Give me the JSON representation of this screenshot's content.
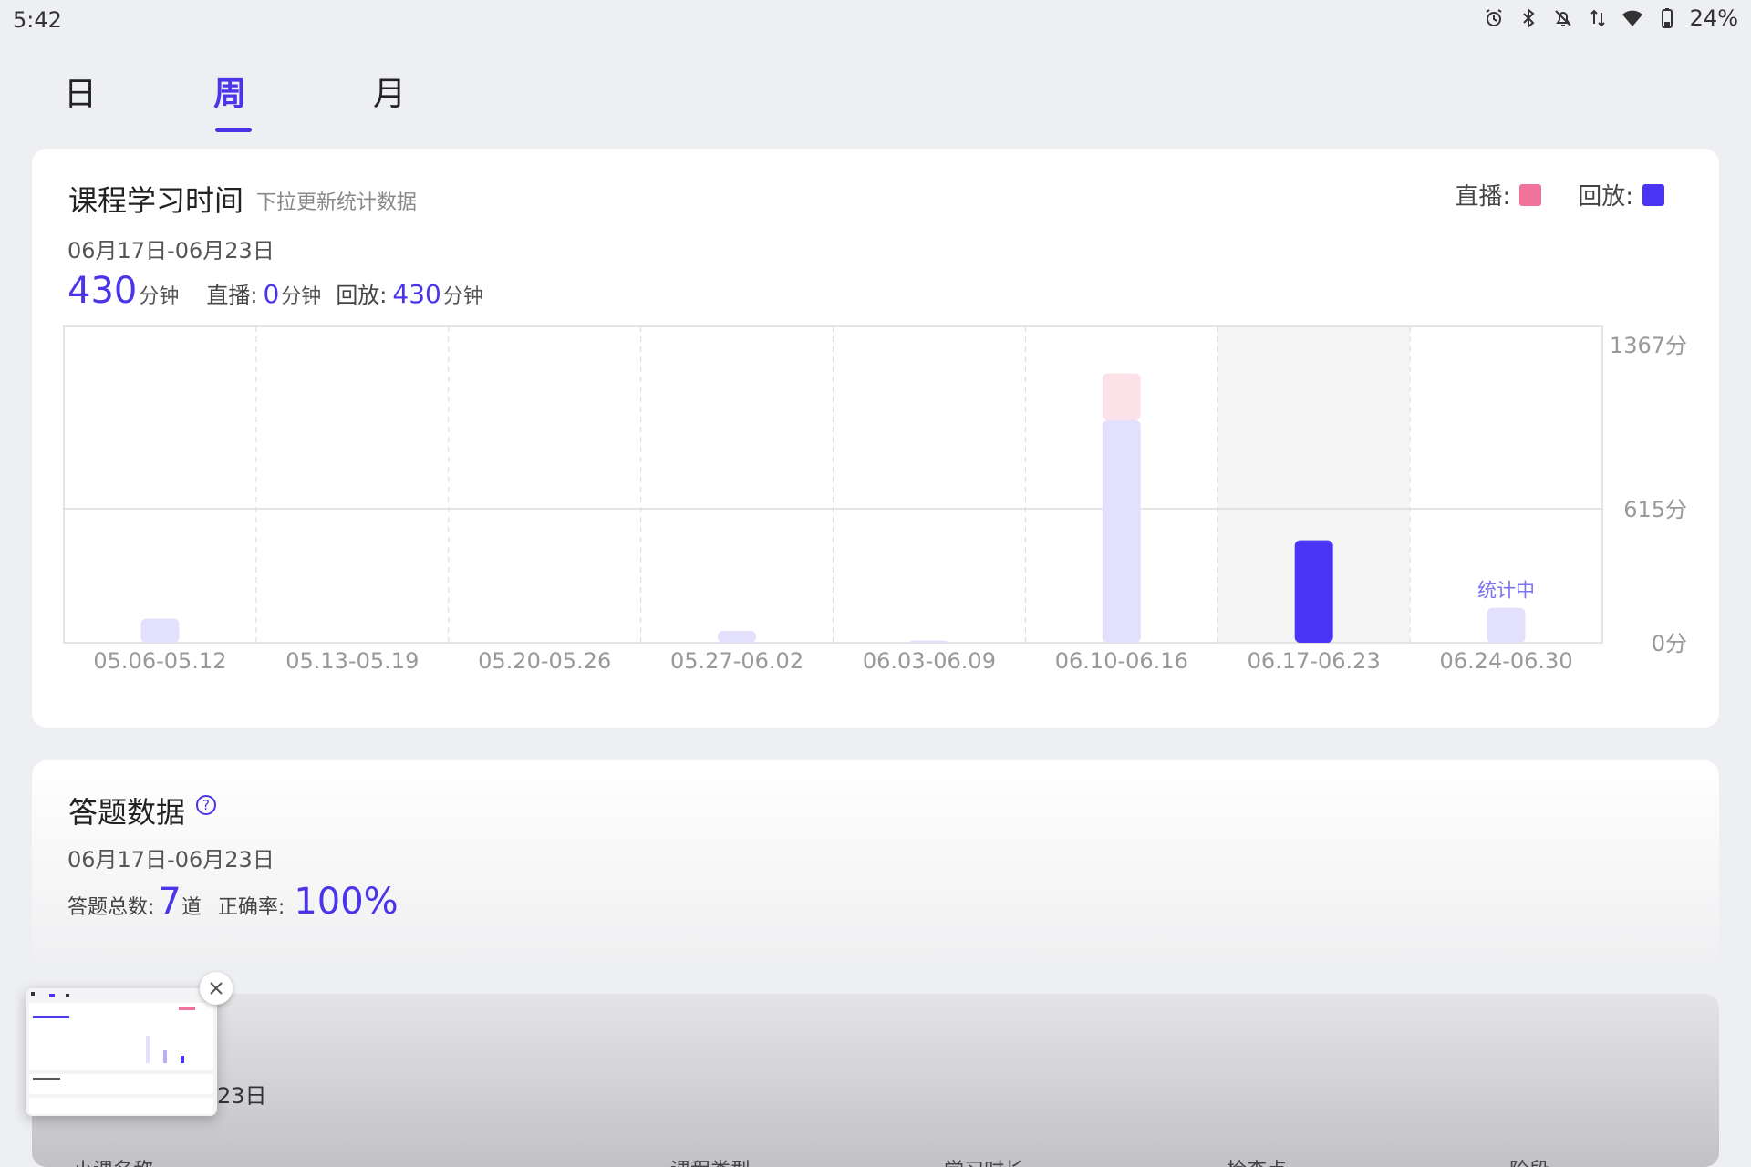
{
  "status_bar": {
    "time": "5:42",
    "battery_text": "24%",
    "icons": [
      "alarm-icon",
      "bluetooth-icon",
      "bell-off-icon",
      "data-arrows-icon",
      "wifi-icon",
      "battery-icon"
    ]
  },
  "tabs": [
    {
      "label": "日",
      "active": false
    },
    {
      "label": "周",
      "active": true
    },
    {
      "label": "月",
      "active": false
    }
  ],
  "study_card": {
    "title": "课程学习时间",
    "subtitle": "下拉更新统计数据",
    "date_range": "06月17日-06月23日",
    "total_value": "430",
    "unit": "分钟",
    "live_label": "直播:",
    "live_value": "0",
    "replay_label": "回放:",
    "replay_value": "430",
    "legend": {
      "live_label": "直播:",
      "replay_label": "回放:",
      "live_color": "#f0739b",
      "replay_color": "#4b35f5"
    }
  },
  "chart_data": {
    "type": "bar",
    "stacked": true,
    "categories": [
      "05.06-05.12",
      "05.13-05.19",
      "05.20-05.26",
      "05.27-06.02",
      "06.03-06.09",
      "06.10-06.16",
      "06.17-06.23",
      "06.24-06.30"
    ],
    "series": [
      {
        "name": "回放",
        "values": [
          110,
          0,
          0,
          55,
          10,
          1020,
          470,
          160
        ]
      },
      {
        "name": "直播",
        "values": [
          0,
          0,
          0,
          0,
          0,
          215,
          0,
          0
        ]
      }
    ],
    "selected_index": 6,
    "in_progress_index": 7,
    "in_progress_label": "统计中",
    "y_ticks": [
      "0分",
      "615分",
      "1367分"
    ],
    "ylim": [
      0,
      1367
    ],
    "colors": {
      "past": "#e3e0fd",
      "live_past": "#fde1e8",
      "selected": "#4b35f5"
    }
  },
  "answer_card": {
    "title": "答题数据",
    "help_icon_text": "?",
    "date_range": "06月17日-06月23日",
    "total_label": "答题总数:",
    "total_value": "7",
    "total_unit": "道",
    "accuracy_label": "正确率:",
    "accuracy_value": "100%"
  },
  "details_card": {
    "date_partial": "23日",
    "columns": [
      "小课名称",
      "课程类型",
      "学习时长",
      "检查点",
      "阶段"
    ]
  }
}
